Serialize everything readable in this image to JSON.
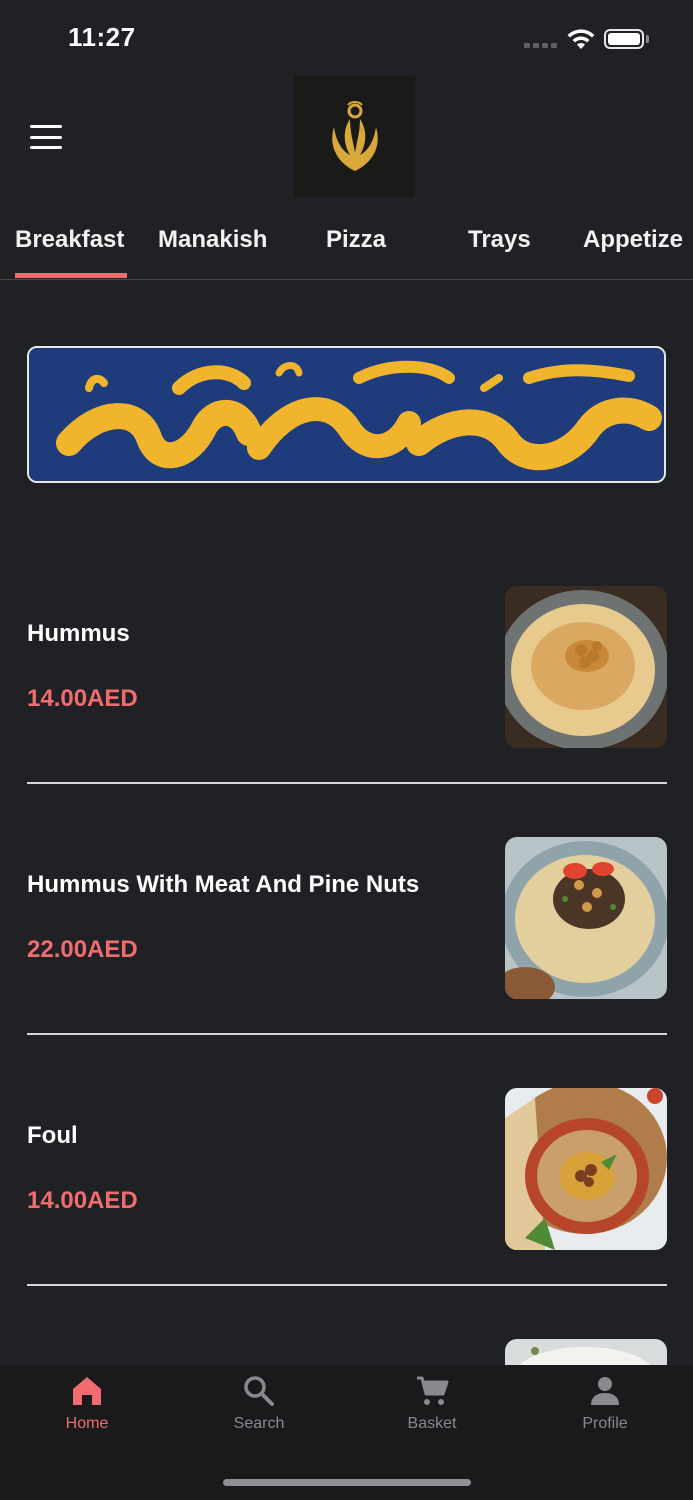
{
  "status_bar": {
    "time": "11:27"
  },
  "tabs": [
    {
      "label": "Breakfast",
      "active": true
    },
    {
      "label": "Manakish"
    },
    {
      "label": "Pizza"
    },
    {
      "label": "Trays"
    },
    {
      "label": "Appetize"
    }
  ],
  "colors": {
    "accent": "#f16c6f",
    "background": "#202125",
    "banner_blue": "#1e3c7c",
    "banner_gold": "#f0b52d"
  },
  "menu_items": [
    {
      "name": "Hummus",
      "price": "14.00AED"
    },
    {
      "name": "Hummus With Meat And Pine Nuts",
      "price": "22.00AED"
    },
    {
      "name": "Foul",
      "price": "14.00AED"
    }
  ],
  "bottom_nav": [
    {
      "label": "Home",
      "icon": "home-icon",
      "active": true
    },
    {
      "label": "Search",
      "icon": "search-icon"
    },
    {
      "label": "Basket",
      "icon": "cart-icon"
    },
    {
      "label": "Profile",
      "icon": "person-icon"
    }
  ]
}
